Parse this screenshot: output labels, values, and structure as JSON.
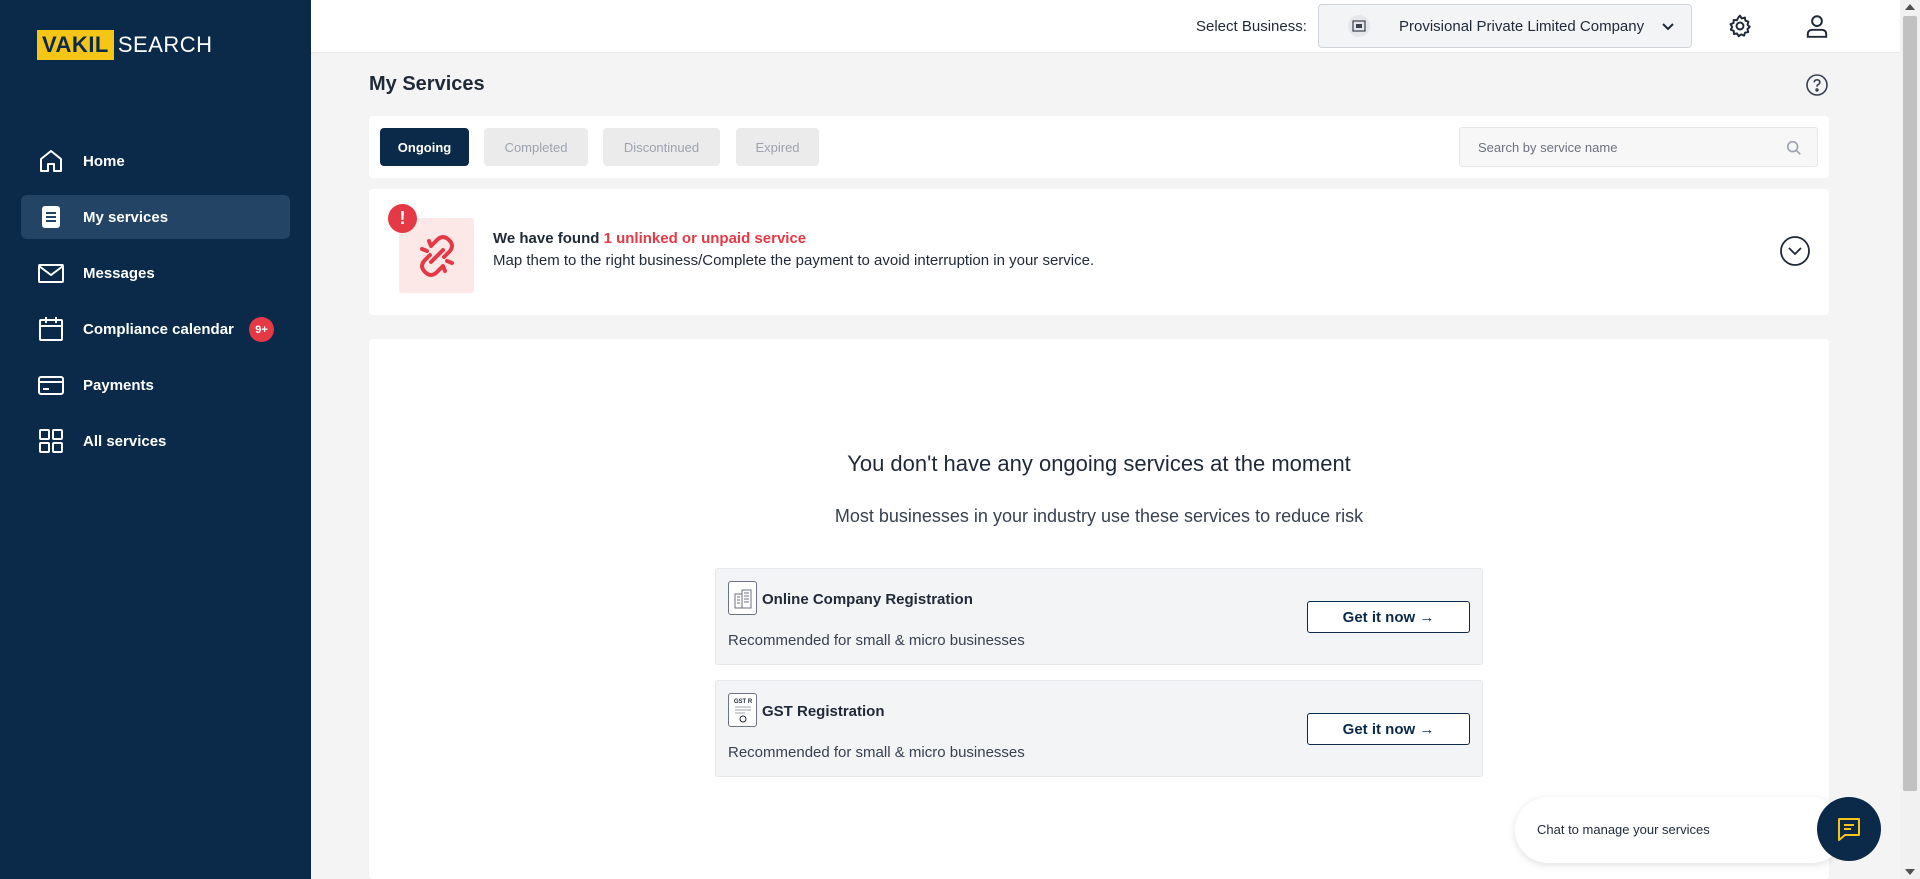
{
  "brand": {
    "logo_box": "VAKIL",
    "logo_text": "SEARCH"
  },
  "sidebar": {
    "items": [
      {
        "label": "Home",
        "icon": "home-icon",
        "active": false
      },
      {
        "label": "My services",
        "icon": "document-icon",
        "active": true
      },
      {
        "label": "Messages",
        "icon": "mail-icon",
        "active": false
      },
      {
        "label": "Compliance calendar",
        "icon": "calendar-icon",
        "active": false,
        "badge": "9+"
      },
      {
        "label": "Payments",
        "icon": "credit-card-icon",
        "active": false
      },
      {
        "label": "All services",
        "icon": "grid-icon",
        "active": false
      }
    ]
  },
  "header": {
    "select_label": "Select Business:",
    "business_name": "Provisional Private Limited Company",
    "icons": [
      "gear-icon",
      "user-icon",
      "chevron-down-icon"
    ]
  },
  "main": {
    "title": "My Services",
    "tabs": [
      {
        "label": "Ongoing",
        "active": true
      },
      {
        "label": "Completed",
        "active": false
      },
      {
        "label": "Discontinued",
        "active": false
      },
      {
        "label": "Expired",
        "active": false
      }
    ],
    "search": {
      "placeholder": "Search by service name",
      "value": ""
    },
    "alert": {
      "badge": "!",
      "lead": "We have found",
      "highlight": "1 unlinked or unpaid service",
      "message": "Map them to the right business/Complete the payment to avoid interruption in your service."
    },
    "empty": {
      "title": "You don't have any ongoing services at the moment",
      "subtitle": "Most businesses in your industry use these services to reduce risk"
    },
    "services": [
      {
        "name": "Online Company Registration",
        "description": "Recommended for small & micro businesses",
        "button": "Get it now →",
        "icon": "building-icon"
      },
      {
        "name": "GST Registration",
        "description": "Recommended for small & micro businesses",
        "button": "Get it now →",
        "icon": "gst-certificate-icon",
        "icon_text": "GST R"
      }
    ]
  },
  "chat": {
    "label": "Chat to manage your services",
    "icon": "chat-icon"
  },
  "colors": {
    "navy": "#0b2a4a",
    "accent_red": "#e63946",
    "logo_yellow": "#f5c518"
  }
}
